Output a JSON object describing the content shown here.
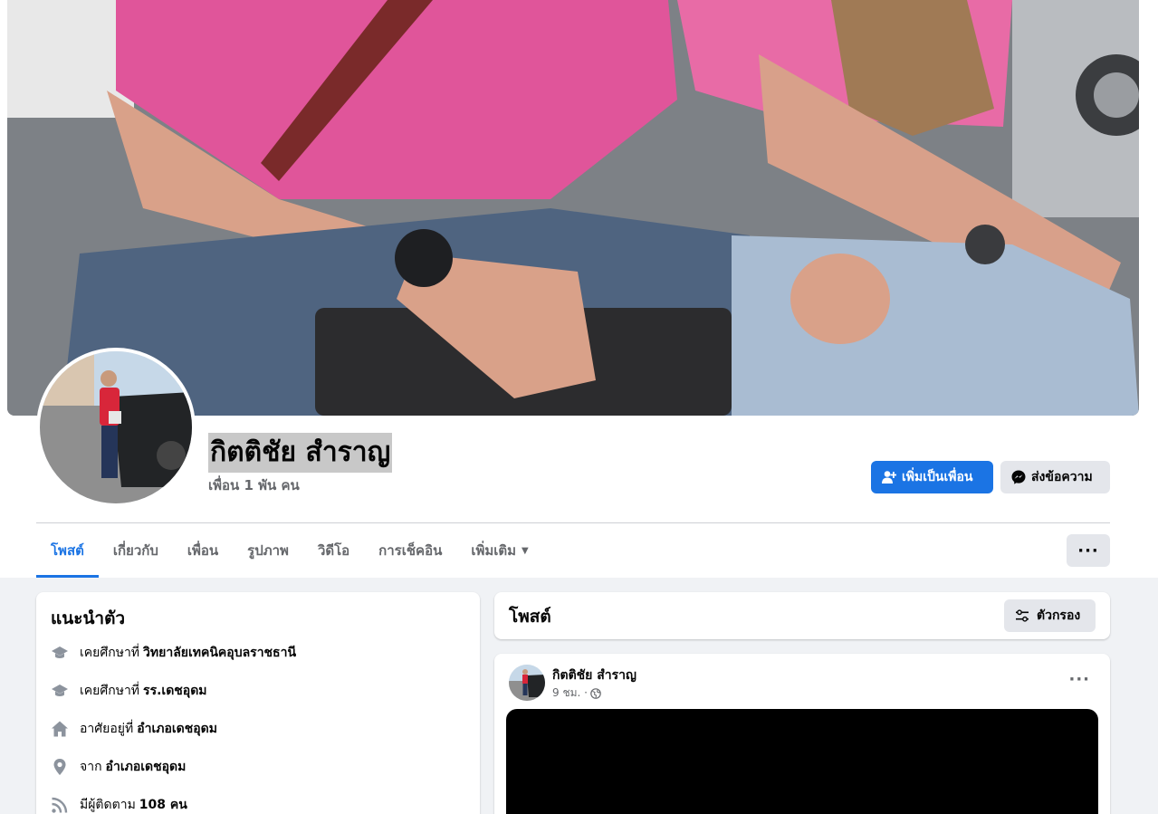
{
  "profile": {
    "name": "กิตติชัย สำราญ",
    "friends": "เพื่อน 1 พัน คน"
  },
  "actions": {
    "add_friend": "เพิ่มเป็นเพื่อน",
    "message": "ส่งข้อความ"
  },
  "tabs": [
    {
      "label": "โพสต์",
      "active": true
    },
    {
      "label": "เกี่ยวกับ",
      "active": false
    },
    {
      "label": "เพื่อน",
      "active": false
    },
    {
      "label": "รูปภาพ",
      "active": false
    },
    {
      "label": "วิดีโอ",
      "active": false
    },
    {
      "label": "การเช็คอิน",
      "active": false
    },
    {
      "label": "เพิ่มเติม",
      "active": false
    }
  ],
  "more_button": "···",
  "intro": {
    "title": "แนะนำตัว",
    "items": [
      {
        "icon": "graduation-cap-icon",
        "prefix": "เคยศึกษาที่",
        "value": "วิทยาลัยเทคนิคอุบลราชธานี"
      },
      {
        "icon": "graduation-cap-icon",
        "prefix": "เคยศึกษาที่",
        "value": "รร.เดชอุดม"
      },
      {
        "icon": "home-icon",
        "prefix": "อาศัยอยู่ที่",
        "value": "อำเภอเดชอุดม"
      },
      {
        "icon": "location-pin-icon",
        "prefix": "จาก",
        "value": "อำเภอเดชอุดม"
      },
      {
        "icon": "rss-icon",
        "prefix": "มีผู้ติดตาม",
        "value": "108 คน"
      }
    ]
  },
  "posts": {
    "title": "โพสต์",
    "filter_label": "ตัวกรอง"
  },
  "post": {
    "author": "กิตติชัย สำราญ",
    "time": "9 ชม. ·",
    "privacy_icon": "globe-icon",
    "options": "···"
  },
  "colors": {
    "accent": "#1b74e4",
    "page_bg": "#f0f2f5",
    "secondary_button": "#e4e6eb",
    "secondary_text": "#65676b"
  }
}
